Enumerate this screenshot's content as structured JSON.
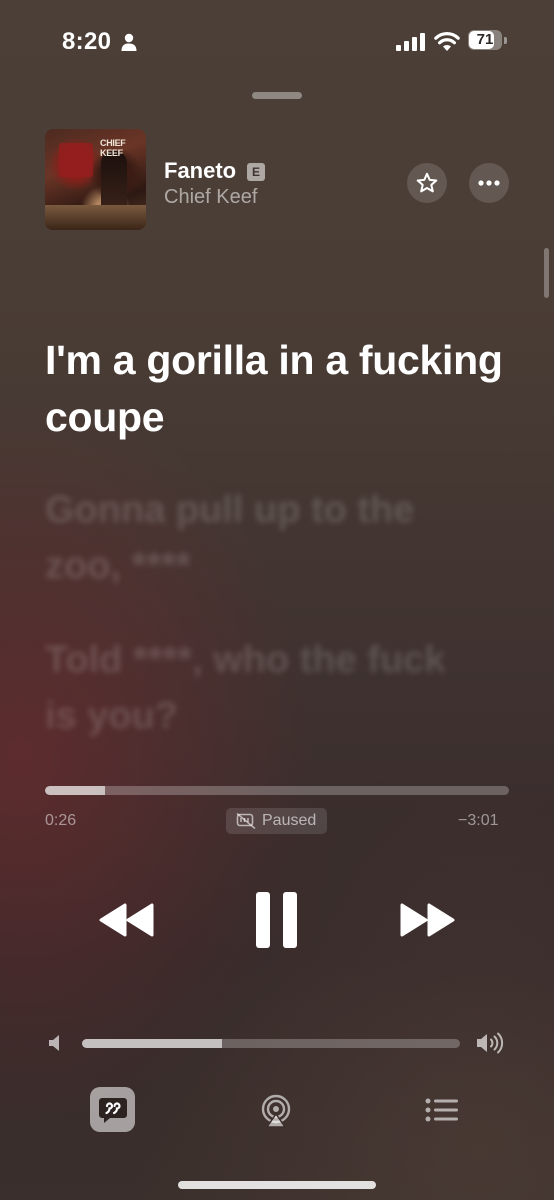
{
  "status_bar": {
    "time": "8:20",
    "battery_level": "71",
    "icons": [
      "person-icon",
      "signal-icon",
      "wifi-icon",
      "battery-icon"
    ]
  },
  "now_playing": {
    "title": "Faneto",
    "explicit_badge": "E",
    "artist": "Chief Keef",
    "artwork_brand": "CHIEF KEEF"
  },
  "lyrics": {
    "current_line": "I'm a gorilla in a fucking coupe",
    "next_lines": [
      "Gonna pull up to the zoo, ****",
      "Told ****, who the fuck is you?"
    ]
  },
  "playback": {
    "elapsed": "0:26",
    "remaining": "−3:01",
    "state_label": "Paused",
    "progress_fraction": 0.13
  },
  "volume": {
    "level_fraction": 0.37
  },
  "bottom_bar": {
    "items": [
      "lyrics-icon",
      "airplay-icon",
      "queue-icon"
    ]
  },
  "colors": {
    "background_top": "#4b3f37",
    "background_bottom": "#362a2a",
    "accent": "#ffffff"
  }
}
